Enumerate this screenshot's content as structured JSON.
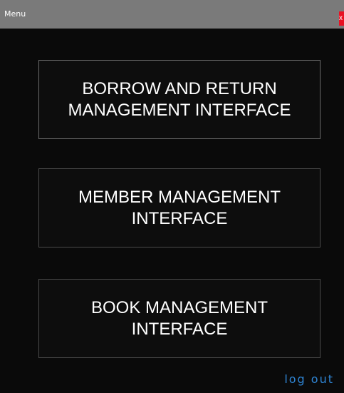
{
  "window": {
    "title": "Menu",
    "close_label": "x"
  },
  "menu": {
    "buttons": [
      {
        "label": "BORROW AND RETURN\nMANAGEMENT INTERFACE"
      },
      {
        "label": "MEMBER MANAGEMENT\nINTERFACE"
      },
      {
        "label": "BOOK MANAGEMENT\nINTERFACE"
      }
    ]
  },
  "footer": {
    "logout_label": "log out"
  },
  "colors": {
    "titlebar": "#7a7a7a",
    "background": "#000000",
    "close": "#e81123",
    "link": "#2f86d6"
  }
}
